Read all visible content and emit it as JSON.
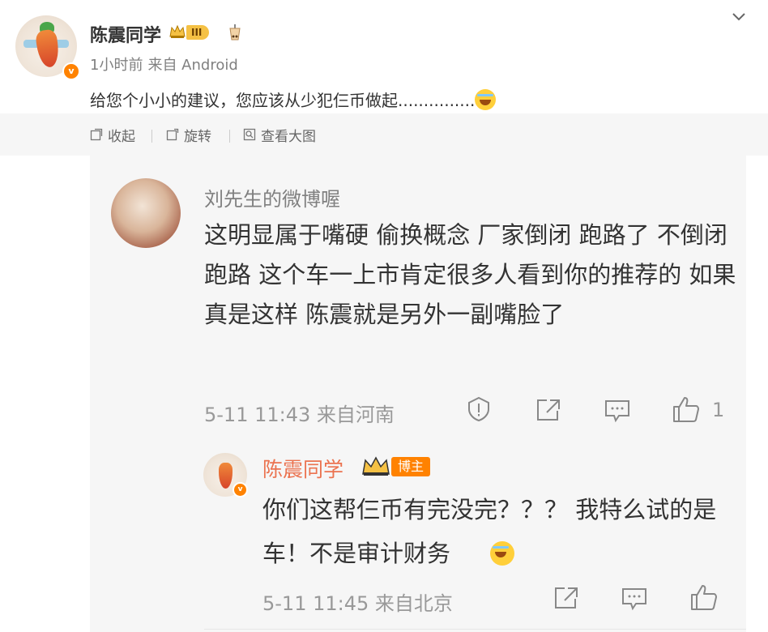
{
  "post": {
    "author": "陈震同学",
    "level_badge": "III",
    "time": "1小时前",
    "source": "来自 Android",
    "text": "给您个小小的建议，您应该从少犯仨币做起...............",
    "actions": [
      "收起",
      "旋转",
      "查看大图"
    ]
  },
  "comment": {
    "author": "刘先生的微博喔",
    "text": "这明显属于嘴硬 偷换概念 厂家倒闭 跑路了 不倒闭跑路 这个车一上市肯定很多人看到你的推荐的 如果真是这样 陈震就是另外一副嘴脸了",
    "time": "5-11 11:43",
    "source": "来自河南",
    "like_count": "1"
  },
  "reply": {
    "author": "陈震同学",
    "author_badge": "博主",
    "text": "你们这帮仨币有完没完？？？ 我特么试的是车！不是审计财务",
    "time": "5-11 11:45",
    "source": "来自北京"
  },
  "icons": {
    "collapse": "collapse-icon",
    "rotate": "rotate-icon",
    "view_large": "view-large-icon",
    "report": "report-icon",
    "share": "share-icon",
    "comment": "comment-icon",
    "like": "like-icon",
    "more": "chevron-down-icon"
  },
  "colors": {
    "accent_orange": "#ff8200",
    "name_orange": "#eb7350",
    "panel_bg": "#f6f6f6",
    "muted_text": "#999999"
  }
}
